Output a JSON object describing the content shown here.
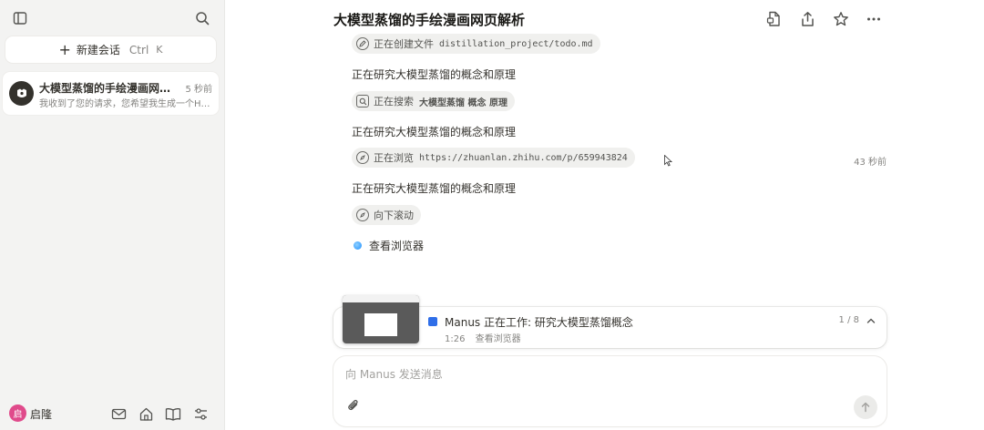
{
  "sidebar": {
    "new_chat_label": "新建会话",
    "shortcut_ctrl": "Ctrl",
    "shortcut_key": "K",
    "tasks": [
      {
        "title": "大模型蒸馏的手绘漫画网页...",
        "time": "5 秒前",
        "preview": "我收到了您的请求，您希望我生成一个HT..."
      }
    ],
    "user": {
      "avatar_text": "启",
      "name": "启隆",
      "avatar_color": "#e04a8b"
    }
  },
  "header": {
    "title": "大模型蒸馏的手绘漫画网页解析"
  },
  "steps": {
    "pill_create_label": "正在创建文件",
    "pill_create_path": "distillation_project/todo.md",
    "step_text_1": "正在研究大模型蒸馏的概念和原理",
    "pill_search_label": "正在搜索",
    "pill_search_keywords": "大模型蒸馏  概念  原理",
    "step_text_2": "正在研究大模型蒸馏的概念和原理",
    "pill_browse_label": "正在浏览",
    "pill_browse_url": "https://zhuanlan.zhihu.com/p/659943824",
    "browse_time": "43 秒前",
    "step_text_3": "正在研究大模型蒸馏的概念和原理",
    "pill_scroll_label": "向下滚动",
    "view_browser_label": "查看浏览器"
  },
  "status_card": {
    "title": "Manus 正在工作: 研究大模型蒸馏概念",
    "elapsed": "1:26",
    "sub_label": "查看浏览器",
    "count": "1 / 8",
    "accent": "#2f6ee8"
  },
  "composer": {
    "placeholder": "向 Manus 发送消息"
  }
}
